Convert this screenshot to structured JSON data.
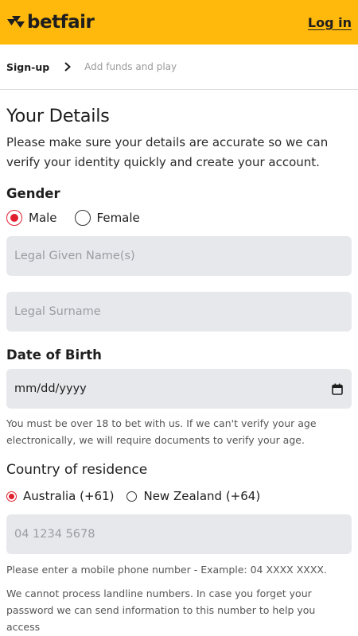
{
  "header": {
    "logo_text": "betfair",
    "login_label": "Log in"
  },
  "steps": {
    "active": "Sign-up",
    "next": "Add funds and play"
  },
  "form": {
    "title": "Your Details",
    "intro": "Please make sure your details are accurate so we can verify your identity quickly and create your account.",
    "gender": {
      "label": "Gender",
      "options": [
        "Male",
        "Female"
      ],
      "selected": "Male"
    },
    "given_name": {
      "placeholder": "Legal Given Name(s)"
    },
    "surname": {
      "placeholder": "Legal Surname"
    },
    "dob": {
      "label": "Date of Birth",
      "value": "mm/dd/yyyy",
      "help": "You must be over 18 to bet with us. If we can't verify your age electronically, we will require documents to verify your age."
    },
    "country": {
      "label": "Country of residence",
      "options": [
        "Australia (+61)",
        "New Zealand (+64)"
      ],
      "selected": "Australia (+61)"
    },
    "mobile": {
      "placeholder": "04 1234 5678",
      "help": "Please enter a mobile phone number - Example: 04 XXXX XXXX.",
      "landline_note": "We cannot process landline numbers. In case you forget your password we can send information to this number to help you access"
    }
  },
  "colors": {
    "header_bg": "#ffb80c",
    "radio_selected": "#e02030",
    "field_bg": "#e7e8ec"
  }
}
